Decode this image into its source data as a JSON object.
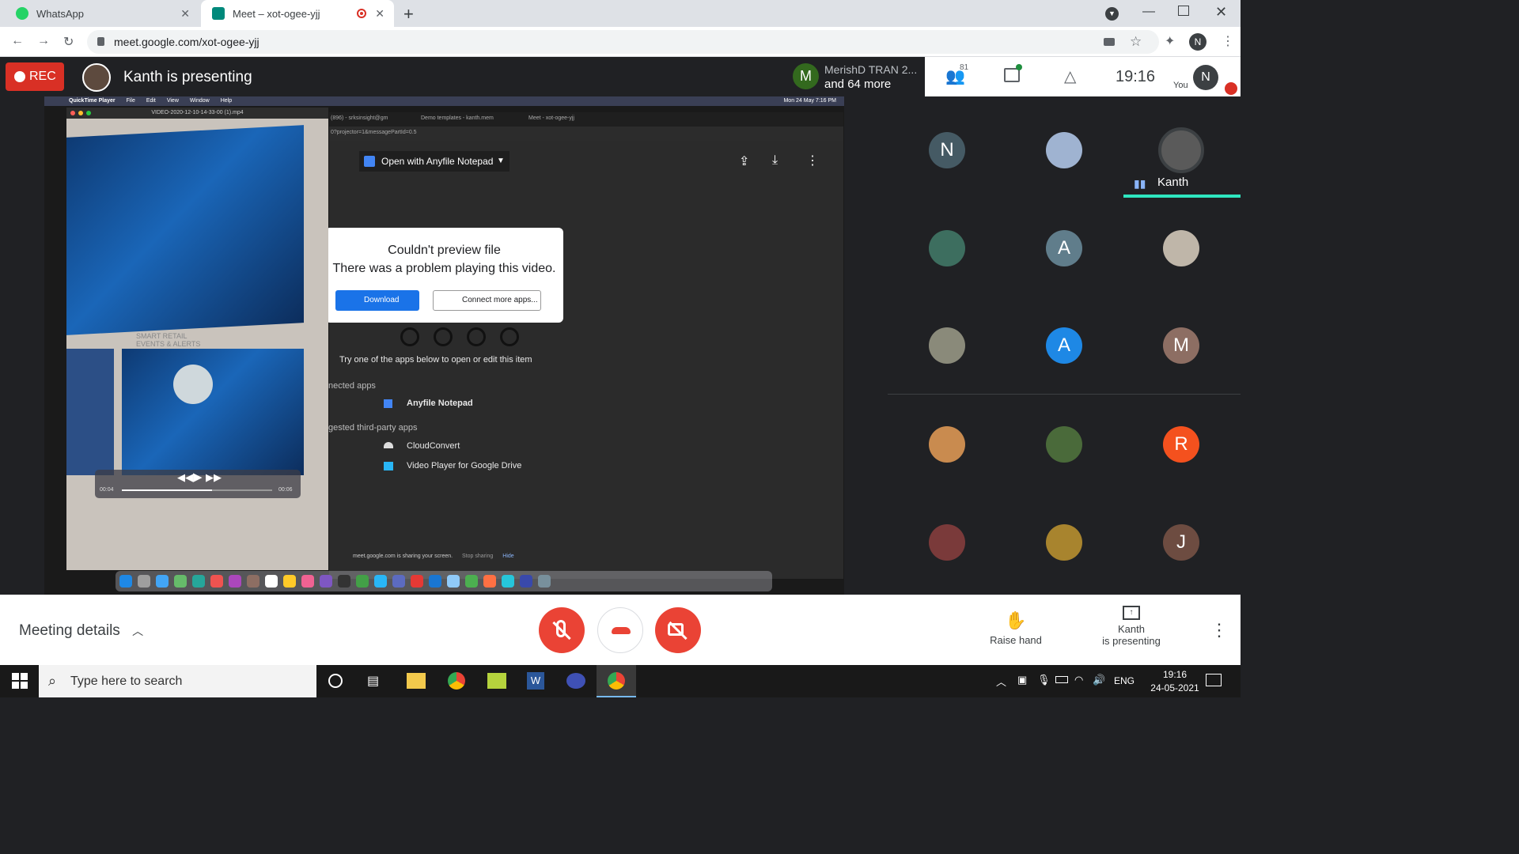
{
  "browser": {
    "tabs": [
      {
        "label": "WhatsApp",
        "active": false
      },
      {
        "label": "Meet – xot-ogee-yjj",
        "active": true
      }
    ],
    "url": "meet.google.com/xot-ogee-yjj",
    "profile_initial": "N"
  },
  "meet": {
    "rec_label": "REC",
    "presenting_title": "Kanth is presenting",
    "participant_stack": {
      "initial": "M",
      "line1": "MerishD TRAN 2...",
      "line2": "and 64 more"
    },
    "people_count": "81",
    "clock": "19:16",
    "you_label": "You",
    "you_initial": "N",
    "grid": [
      {
        "initial": "N",
        "color": "#455a64"
      },
      {
        "initial": "",
        "color": "#9fb3d1"
      },
      {
        "initial": "",
        "color": "#5a5a5a",
        "name": "Kanth",
        "speaking": true
      },
      {
        "initial": "",
        "color": "#3d6e5f"
      },
      {
        "initial": "A",
        "color": "#607d8b"
      },
      {
        "initial": "",
        "color": "#bfb6a9"
      },
      {
        "initial": "",
        "color": "#8a8a7a"
      },
      {
        "initial": "A",
        "color": "#1e88e5"
      },
      {
        "initial": "M",
        "color": "#8d6e63"
      },
      {
        "initial": "",
        "color": "#c98b4f"
      },
      {
        "initial": "",
        "color": "#4a6a3a"
      },
      {
        "initial": "R",
        "color": "#f4511e"
      },
      {
        "initial": "",
        "color": "#7a3a3a"
      },
      {
        "initial": "",
        "color": "#a8842e"
      },
      {
        "initial": "J",
        "color": "#6d4c41"
      }
    ],
    "meeting_details_label": "Meeting details",
    "raise_hand_label": "Raise hand",
    "presenting_label_1": "Kanth",
    "presenting_label_2": "is presenting"
  },
  "shared_screen": {
    "mac_menu": [
      "QuickTime Player",
      "File",
      "Edit",
      "View",
      "Window",
      "Help"
    ],
    "mac_clock": "Mon 24 May  7:16 PM",
    "video_filename": "VIDEO-2020-12-10-14-33-00 (1).mp4",
    "video_overlay_text_1": "SMART RETAIL",
    "video_overlay_text_2": "EVENTS & ALERTS",
    "video_time_start": "00:04",
    "video_time_end": "00:06",
    "video_progress": 0.6,
    "drive_tabs": [
      "(896) - srksinsight@gm",
      "Demo templates - kanth.mem",
      "Meet - xot-ogee-yjj"
    ],
    "drive_url_fragment": "0?projector=1&messagePartId=0.5",
    "open_with_label": "Open with Anyfile Notepad",
    "error_title": "Couldn't preview file",
    "error_message": "There was a problem playing this video.",
    "download_label": "Download",
    "connect_label": "Connect more apps...",
    "try_text": "Try one of the apps below to open or edit this item",
    "connected_header": "nected apps",
    "connected_app": "Anyfile Notepad",
    "suggested_header": "gested third-party apps",
    "suggested_apps": [
      "CloudConvert",
      "Video Player for Google Drive"
    ],
    "sharing_notice": "meet.google.com is sharing your screen.",
    "stop_sharing": "Stop sharing",
    "hide": "Hide"
  },
  "taskbar": {
    "search_placeholder": "Type here to search",
    "lang": "ENG",
    "time": "19:16",
    "date": "24-05-2021"
  }
}
